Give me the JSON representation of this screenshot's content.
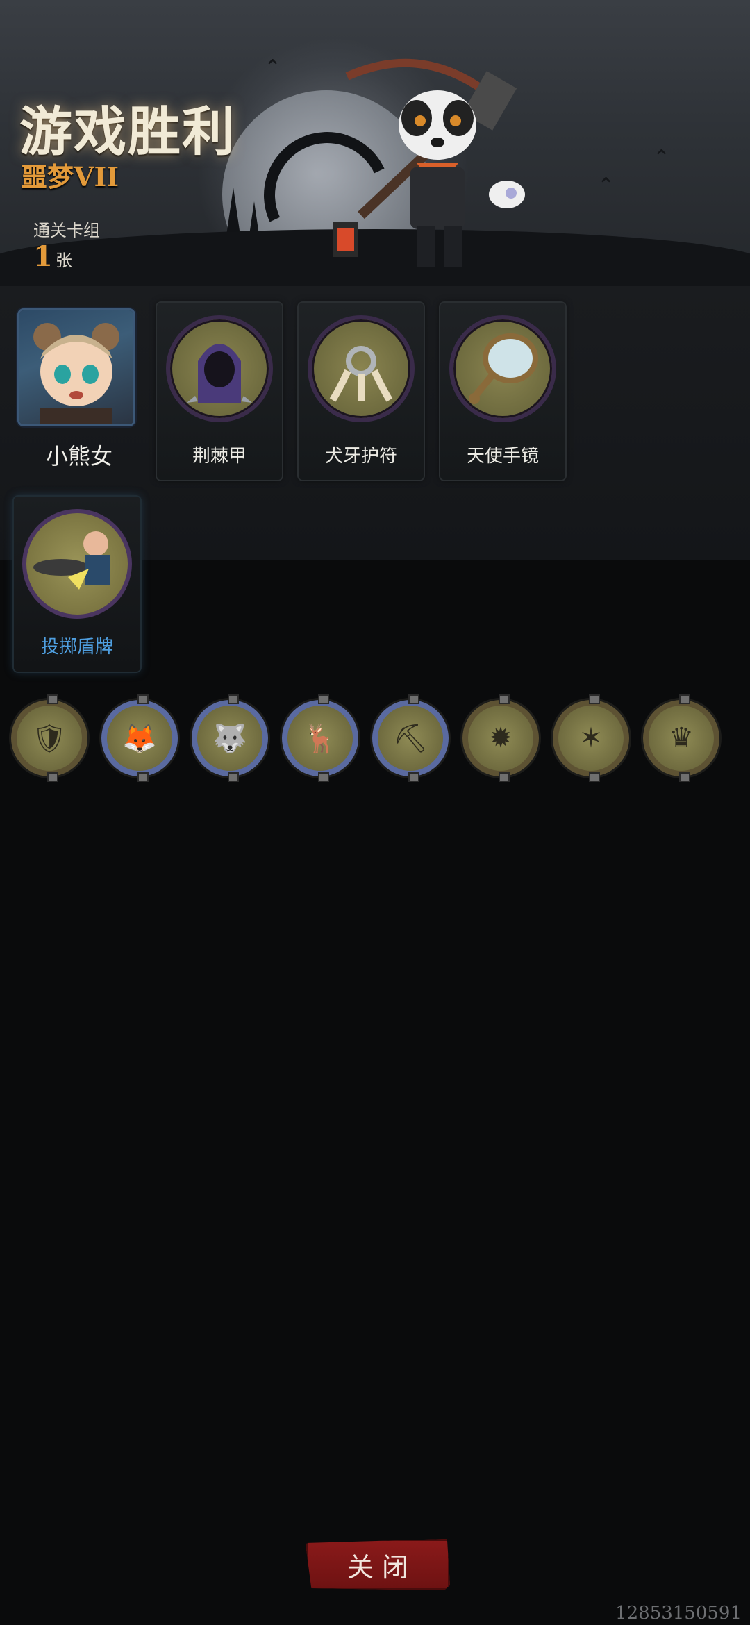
{
  "header": {
    "title": "游戏胜利",
    "difficulty": "噩梦VII",
    "clear_deck_label": "通关卡组",
    "clear_deck_count": "1",
    "clear_deck_unit": "张"
  },
  "hero": {
    "name": "小熊女",
    "icon": "bear-girl-portrait"
  },
  "reward_cards": [
    {
      "label": "荆棘甲",
      "icon": "thorn-armor-icon"
    },
    {
      "label": "犬牙护符",
      "icon": "fang-amulet-icon"
    },
    {
      "label": "天使手镜",
      "icon": "angel-mirror-icon"
    }
  ],
  "thrown_card": {
    "label": "投掷盾牌",
    "icon": "throw-shield-icon"
  },
  "medals": [
    {
      "icon": "bear-shield-medal-icon",
      "frame": "gold"
    },
    {
      "icon": "fox-runner-medal-icon",
      "frame": "blue"
    },
    {
      "icon": "wolf-medal-icon",
      "frame": "blue"
    },
    {
      "icon": "deer-medal-icon",
      "frame": "blue"
    },
    {
      "icon": "miner-medal-icon",
      "frame": "blue"
    },
    {
      "icon": "spiked-shield-medal-icon",
      "frame": "gold"
    },
    {
      "icon": "spike-trap-medal-icon",
      "frame": "gold"
    },
    {
      "icon": "bear-girl-medal-icon",
      "frame": "gold"
    }
  ],
  "close_button": "关 闭",
  "user_id": "12853150591",
  "colors": {
    "accent_orange": "#e39a3a",
    "close_red": "#7a1414",
    "link_blue": "#4f9fe0"
  }
}
